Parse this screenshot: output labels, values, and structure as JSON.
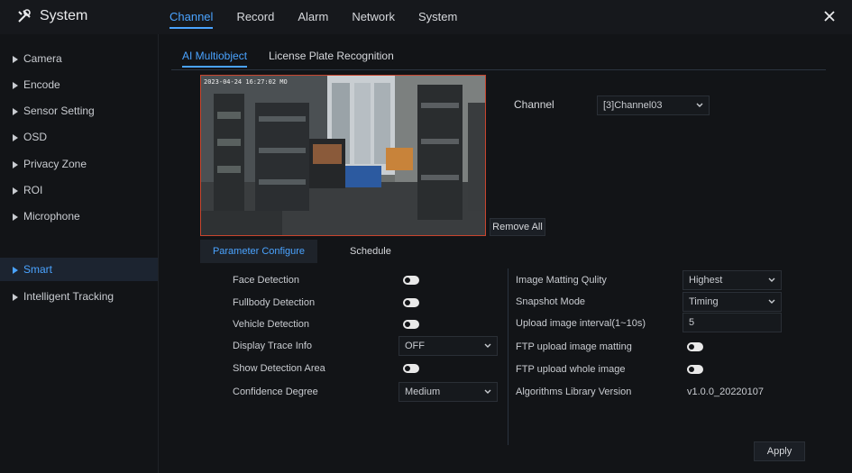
{
  "app": {
    "title": "System"
  },
  "top_tabs": [
    "Channel",
    "Record",
    "Alarm",
    "Network",
    "System"
  ],
  "sidebar": [
    {
      "label": "Camera"
    },
    {
      "label": "Encode"
    },
    {
      "label": "Sensor Setting"
    },
    {
      "label": "OSD"
    },
    {
      "label": "Privacy Zone"
    },
    {
      "label": "ROI"
    },
    {
      "label": "Microphone"
    },
    {
      "label": "Smart",
      "active": true
    },
    {
      "label": "Intelligent Tracking"
    }
  ],
  "sub_tabs": [
    "AI Multiobject",
    "License Plate Recognition"
  ],
  "video": {
    "timestamp": "2023-04-24 16:27:02 MO"
  },
  "buttons": {
    "remove_all": "Remove All",
    "apply": "Apply"
  },
  "channel": {
    "label": "Channel",
    "value": "[3]Channel03"
  },
  "param_tabs": [
    "Parameter Configure",
    "Schedule"
  ],
  "left_settings": [
    {
      "label": "Face Detection",
      "type": "toggle",
      "state": "on"
    },
    {
      "label": "Fullbody Detection",
      "type": "toggle",
      "state": "on"
    },
    {
      "label": "Vehicle Detection",
      "type": "toggle",
      "state": "on"
    },
    {
      "label": "Display Trace Info",
      "type": "select",
      "value": "OFF"
    },
    {
      "label": "Show Detection Area",
      "type": "toggle",
      "state": "on"
    },
    {
      "label": "Confidence Degree",
      "type": "select",
      "value": "Medium"
    }
  ],
  "right_settings": [
    {
      "label": "Image Matting Qulity",
      "type": "select",
      "value": "Highest"
    },
    {
      "label": "Snapshot Mode",
      "type": "select",
      "value": "Timing"
    },
    {
      "label": "Upload image interval(1~10s)",
      "type": "input",
      "value": "5"
    },
    {
      "label": "FTP upload image matting",
      "type": "toggle",
      "state": "on"
    },
    {
      "label": "FTP upload whole image",
      "type": "toggle",
      "state": "on"
    },
    {
      "label": "Algorithms Library Version",
      "type": "text",
      "value": "v1.0.0_20220107"
    }
  ],
  "colors": {
    "accent": "#4aa3ff",
    "bg": "#121417",
    "panel": "#16181c",
    "border": "#2b3440"
  }
}
